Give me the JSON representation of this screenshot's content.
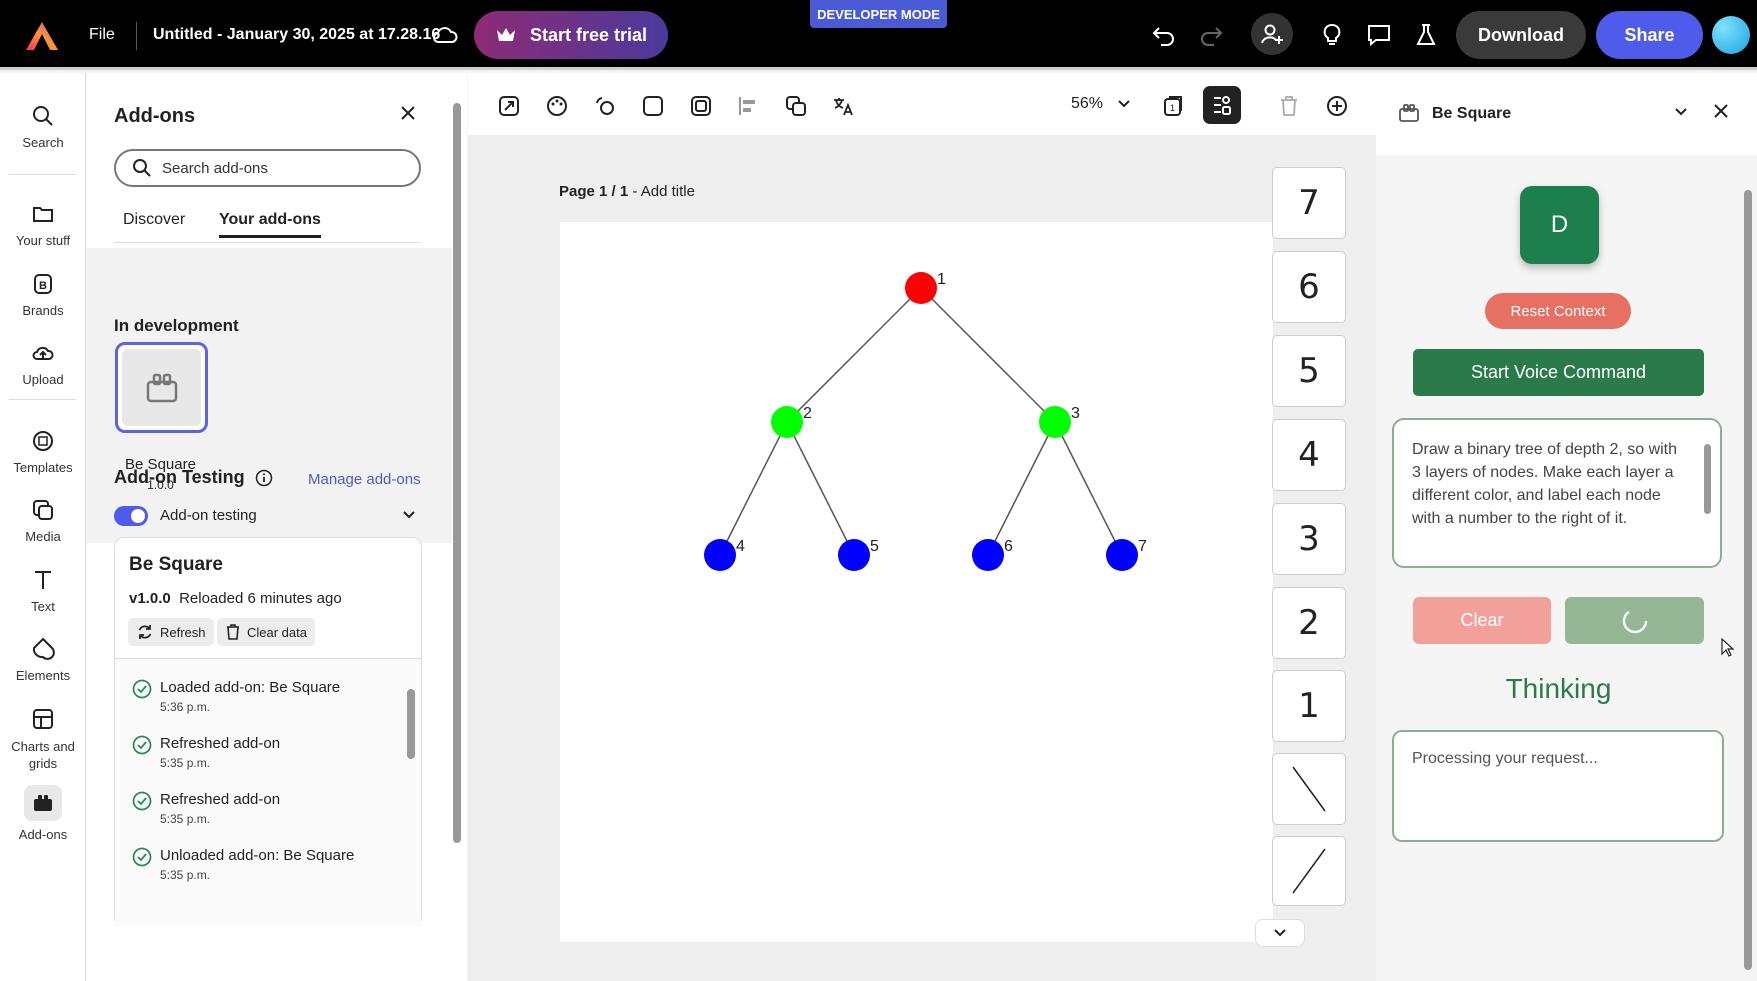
{
  "topbar": {
    "file_label": "File",
    "doc_title": "Untitled - January 30, 2025 at 17.28.16",
    "trial_label": "Start free trial",
    "dev_mode_label": "DEVELOPER MODE",
    "download_label": "Download",
    "share_label": "Share"
  },
  "rail": {
    "items": [
      {
        "label": "Search",
        "icon": "search-icon"
      },
      {
        "label": "Your stuff",
        "icon": "folder-icon"
      },
      {
        "label": "Brands",
        "icon": "brand-icon"
      },
      {
        "label": "Upload",
        "icon": "upload-icon"
      },
      {
        "label": "Templates",
        "icon": "templates-icon"
      },
      {
        "label": "Media",
        "icon": "media-icon"
      },
      {
        "label": "Text",
        "icon": "text-icon"
      },
      {
        "label": "Elements",
        "icon": "elements-icon"
      },
      {
        "label": "Charts and grids",
        "icon": "charts-icon"
      },
      {
        "label": "Add-ons",
        "icon": "addons-icon"
      }
    ]
  },
  "addons": {
    "title": "Add-ons",
    "search_placeholder": "Search add-ons",
    "tab_discover": "Discover",
    "tab_yours": "Your add-ons",
    "in_dev_label": "In development",
    "tile_name": "Be Square",
    "tile_version": "1.0.0",
    "testing_title": "Add-on Testing",
    "manage_label": "Manage add-ons",
    "toggle_label": "Add-on testing",
    "card": {
      "title": "Be Square",
      "version": "v1.0.0",
      "reloaded": "Reloaded 6 minutes ago",
      "refresh_label": "Refresh",
      "clear_data_label": "Clear data"
    },
    "log": [
      {
        "text": "Loaded add-on: Be Square",
        "time": "5:36 p.m."
      },
      {
        "text": "Refreshed add-on",
        "time": "5:35 p.m."
      },
      {
        "text": "Refreshed add-on",
        "time": "5:35 p.m."
      },
      {
        "text": "Unloaded add-on: Be Square",
        "time": "5:35 p.m."
      }
    ]
  },
  "canvas": {
    "zoom": "56%",
    "page_label": "Page 1 / 1",
    "add_title": "Add title",
    "tree_labels": [
      "1",
      "2",
      "3",
      "4",
      "5",
      "6",
      "7"
    ],
    "colors": {
      "layer1": "#ff0000",
      "layer2": "#00ff00",
      "layer3": "#0000ff"
    },
    "thumbnails": [
      "7",
      "6",
      "5",
      "4",
      "3",
      "2",
      "1"
    ]
  },
  "panel": {
    "title": "Be Square",
    "avatar_letter": "D",
    "reset_label": "Reset Context",
    "voice_label": "Start Voice Command",
    "prompt_text": "Draw a binary tree of depth 2, so with 3 layers of nodes. Make each layer a different color, and label each node with a number to the right of it.",
    "clear_label": "Clear",
    "status_text": "Thinking",
    "response_text": "Processing your request..."
  }
}
